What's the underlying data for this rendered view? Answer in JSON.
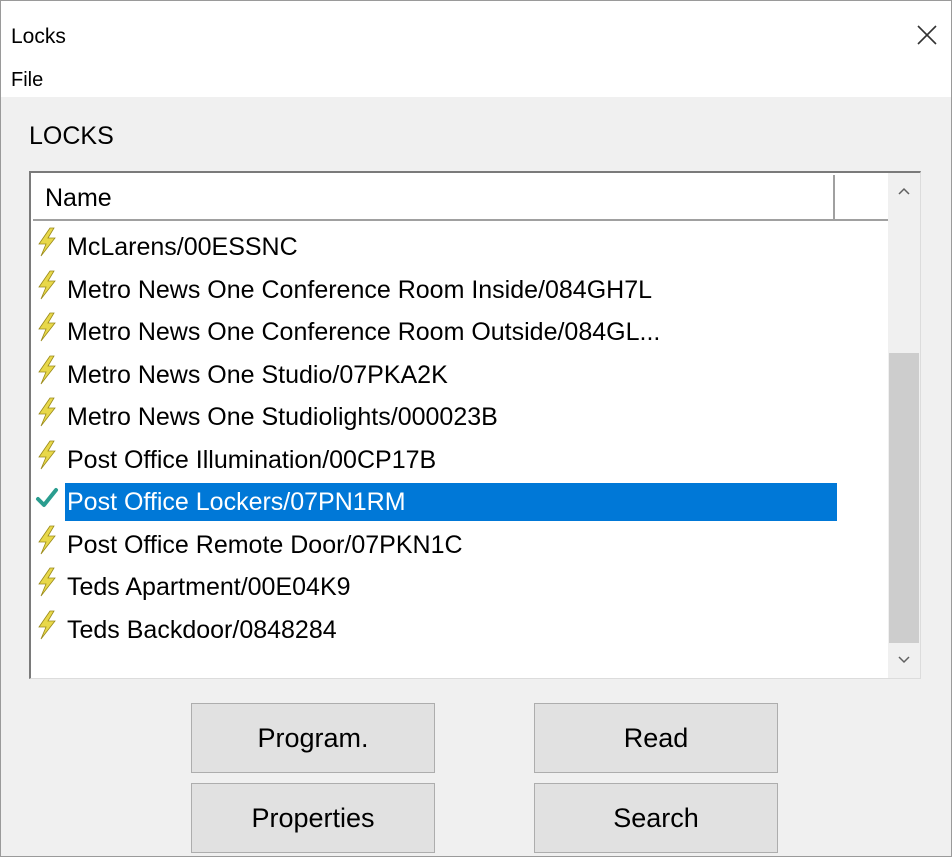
{
  "window": {
    "title": "Locks",
    "close_icon": "close-icon"
  },
  "menu": {
    "file": "File"
  },
  "section": {
    "label": "LOCKS"
  },
  "list": {
    "header_name": "Name",
    "items": [
      {
        "label": "McLarens/00ESSNC",
        "icon": "lightning-icon"
      },
      {
        "label": "Metro News One Conference Room Inside/084GH7L",
        "icon": "lightning-icon"
      },
      {
        "label": "Metro News One Conference Room Outside/084GL...",
        "icon": "lightning-icon"
      },
      {
        "label": "Metro News One Studio/07PKA2K",
        "icon": "lightning-icon"
      },
      {
        "label": "Metro News One Studiolights/000023B",
        "icon": "lightning-icon"
      },
      {
        "label": "Post Office Illumination/00CP17B",
        "icon": "lightning-icon"
      },
      {
        "label": "Post Office Lockers/07PN1RM",
        "icon": "checkmark-icon",
        "selected": true
      },
      {
        "label": "Post Office Remote Door/07PKN1C",
        "icon": "lightning-icon"
      },
      {
        "label": "Teds Apartment/00E04K9",
        "icon": "lightning-icon"
      },
      {
        "label": "Teds Backdoor/0848284",
        "icon": "lightning-icon"
      }
    ]
  },
  "buttons": {
    "program": "Program.",
    "read": "Read",
    "properties": "Properties",
    "search": "Search"
  },
  "colors": {
    "selection": "#0078d7",
    "lightning": "#e8d84a",
    "checkmark": "#2a9d8f"
  }
}
